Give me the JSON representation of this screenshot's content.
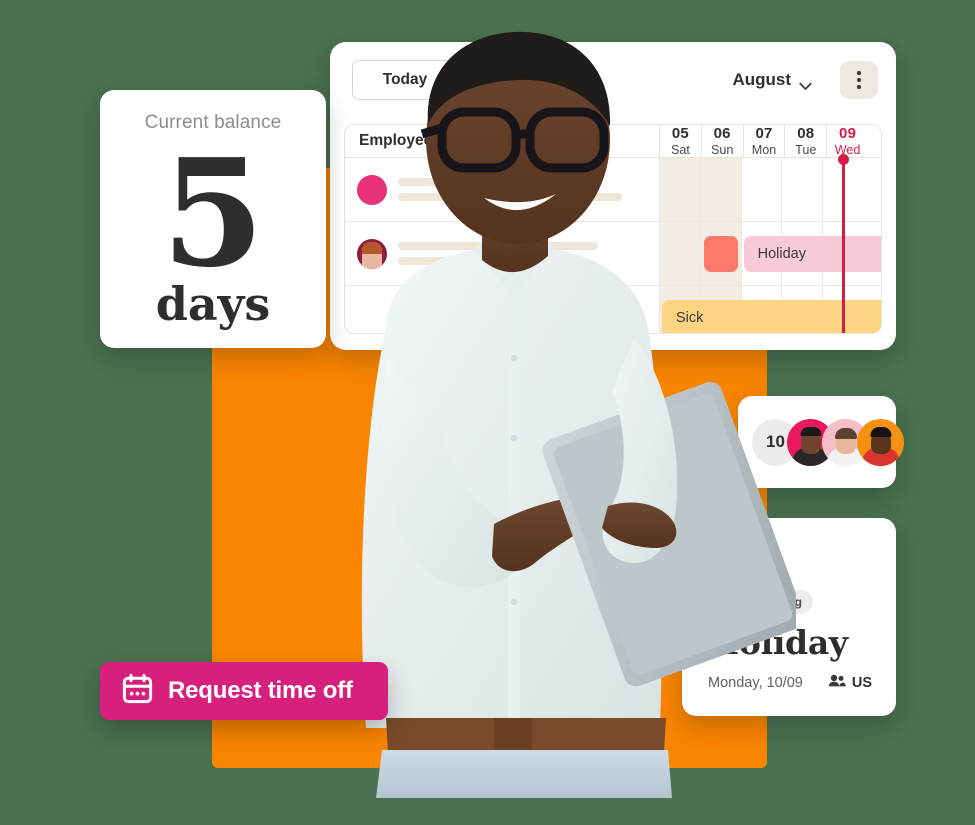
{
  "theme": {
    "background": "#4a7150",
    "orange_panel": "#f98500",
    "accent_pink": "#d71f7c",
    "today_red": "#d81b45",
    "holiday_chip": "#f9cad8",
    "sick_chip": "#fcd484",
    "coral_square": "#fb7a6b",
    "placeholder_beige": "#efe6da",
    "weekend_shade": "#f2ece3",
    "kebab_bg": "#efeae1"
  },
  "balance_card": {
    "label": "Current balance",
    "value": "5",
    "unit": "days"
  },
  "calendar": {
    "toolbar": {
      "today_label": "Today",
      "prev_icon": "chevron-left-icon",
      "next_icon": "chevron-right-icon",
      "month": "August",
      "month_chevron_icon": "chevron-down-icon",
      "menu_icon": "kebab-menu-icon"
    },
    "employees_header": "Employees (381)",
    "days": [
      {
        "num": "05",
        "name": "Sat",
        "weekend": true,
        "today": false
      },
      {
        "num": "06",
        "name": "Sun",
        "weekend": true,
        "today": false
      },
      {
        "num": "07",
        "name": "Mon",
        "weekend": false,
        "today": false
      },
      {
        "num": "08",
        "name": "Tue",
        "weekend": false,
        "today": false
      },
      {
        "num": "09",
        "name": "Wed",
        "weekend": false,
        "today": true
      }
    ],
    "rows": [
      {
        "avatar": "avatar-pink",
        "line_widths": [
          132,
          224
        ]
      },
      {
        "avatar": "avatar-maroon",
        "line_widths": [
          200,
          152
        ]
      },
      {
        "avatar": "none",
        "line_widths": [
          182
        ]
      }
    ],
    "events": [
      {
        "row": 1,
        "type": "square",
        "label": ""
      },
      {
        "row": 1,
        "type": "holiday",
        "label": "Holiday"
      },
      {
        "row": 2,
        "type": "sick",
        "label": "Sick"
      }
    ]
  },
  "avatars_card": {
    "count": "10",
    "people": [
      "avatar-person-1",
      "avatar-person-2",
      "avatar-person-3"
    ]
  },
  "holiday_card": {
    "icon": "beach-umbrella-icon",
    "icon_glyph": "⛱",
    "badge": "Not working",
    "title": "Holiday",
    "date": "Monday, 10/09",
    "country": "US",
    "country_icon": "people-icon"
  },
  "request_button": {
    "label": "Request time off",
    "icon": "calendar-icon"
  }
}
